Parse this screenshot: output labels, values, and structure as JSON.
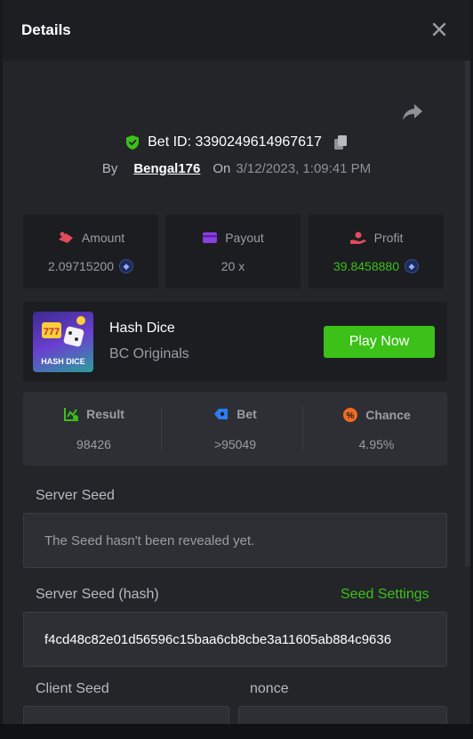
{
  "header": {
    "title": "Details"
  },
  "bet": {
    "id_label": "Bet ID: 3390249614967617",
    "by_label": "By",
    "user": "Bengal176",
    "on_label": "On",
    "date": "3/12/2023, 1:09:41 PM"
  },
  "stats": {
    "amount_label": "Amount",
    "amount_value": "2.09715200",
    "payout_label": "Payout",
    "payout_value": "20 x",
    "profit_label": "Profit",
    "profit_value": "39.8458880"
  },
  "game": {
    "thumb_text": "HASH DICE",
    "name": "Hash Dice",
    "provider": "BC Originals",
    "play_label": "Play Now"
  },
  "result": {
    "result_label": "Result",
    "result_value": "98426",
    "bet_label": "Bet",
    "bet_value": ">95049",
    "chance_label": "Chance",
    "chance_value": "4.95%"
  },
  "seeds": {
    "server_seed_label": "Server Seed",
    "server_seed_value": "The Seed hasn't been revealed yet.",
    "server_hash_label": "Server Seed (hash)",
    "seed_settings_label": "Seed Settings",
    "server_hash_value": "f4cd48c82e01d56596c15baa6cb8cbe3a11605ab884c9636",
    "client_seed_label": "Client Seed",
    "nonce_label": "nonce"
  },
  "colors": {
    "accent_green": "#3bc117",
    "panel": "#232529",
    "card": "#1b1d20"
  },
  "icons": [
    "close-icon",
    "share-icon",
    "shield-check-icon",
    "copy-icon",
    "amount-icon",
    "payout-icon",
    "profit-icon",
    "coin-icon",
    "result-icon",
    "bet-icon",
    "chance-icon"
  ]
}
